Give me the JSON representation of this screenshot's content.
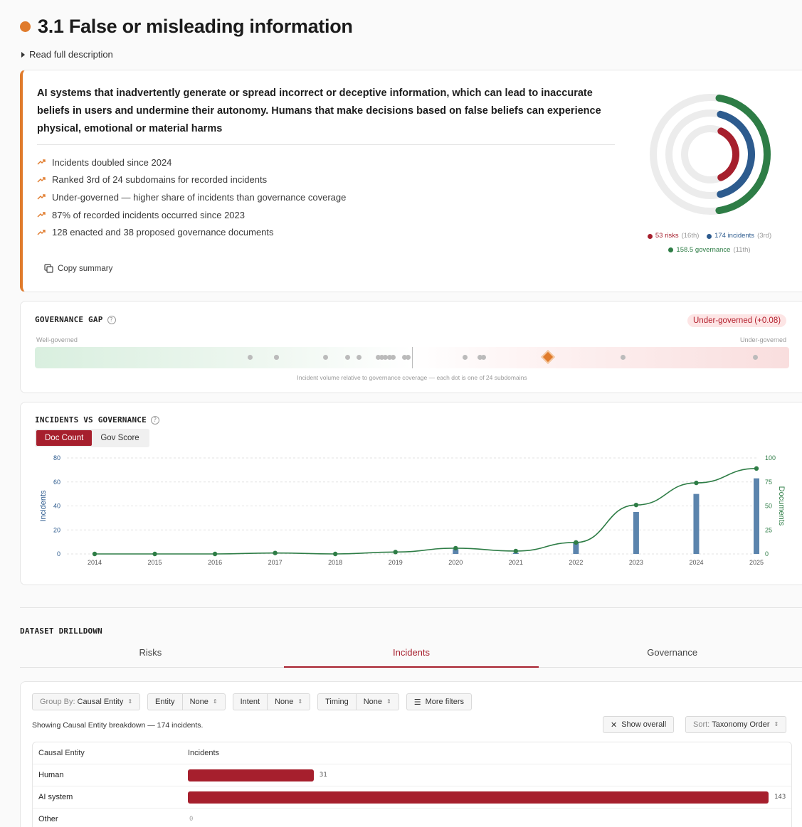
{
  "header": {
    "title": "3.1 False or misleading information",
    "read_description": "Read full description"
  },
  "summary": {
    "lead": "AI systems that inadvertently generate or spread incorrect or deceptive information, which can lead to inaccurate beliefs in users and undermine their autonomy. Humans that make decisions based on false beliefs can experience physical, emotional or material harms",
    "insights": [
      "Incidents doubled since 2024",
      "Ranked 3rd of 24 subdomains for recorded incidents",
      "Under-governed — higher share of incidents than governance coverage",
      "87% of recorded incidents occurred since 2023",
      "128 enacted and 38 proposed governance documents"
    ],
    "copy_label": "Copy summary",
    "rings": {
      "risks": {
        "label": "53 risks",
        "rank": "(16th)",
        "color": "#a61f2d",
        "fraction": 0.36
      },
      "incidents": {
        "label": "174 incidents",
        "rank": "(3rd)",
        "color": "#2d5b8e",
        "fraction": 0.42
      },
      "governance": {
        "label": "158.5 governance",
        "rank": "(11th)",
        "color": "#2e7d46",
        "fraction": 0.45
      }
    },
    "accent_color": "#e07b2c"
  },
  "gap": {
    "label": "GOVERNANCE GAP",
    "badge": "Under-governed (+0.08)",
    "left_label": "Well-governed",
    "right_label": "Under-governed",
    "caption": "Incident volume relative to governance coverage — each dot is one of 24 subdomains",
    "subdomain_scores": [
      0.285,
      0.32,
      0.32,
      0.385,
      0.415,
      0.43,
      0.455,
      0.46,
      0.465,
      0.47,
      0.475,
      0.49,
      0.495,
      0.57,
      0.59,
      0.595,
      0.78,
      0.955
    ],
    "current_score": 0.68
  },
  "chart": {
    "label": "INCIDENTS VS GOVERNANCE",
    "toggle": [
      "Doc Count",
      "Gov Score"
    ],
    "active_toggle": "Doc Count"
  },
  "chart_data": {
    "type": "bar",
    "categories": [
      "2014",
      "2015",
      "2016",
      "2017",
      "2018",
      "2019",
      "2020",
      "2021",
      "2022",
      "2023",
      "2024",
      "2025"
    ],
    "series": [
      {
        "name": "Incidents",
        "type": "bar",
        "axis": "left",
        "color": "#5b84ad",
        "values": [
          0,
          0,
          0,
          0,
          0,
          0,
          4,
          1,
          10,
          35,
          50,
          63
        ]
      },
      {
        "name": "Documents",
        "type": "line",
        "axis": "right",
        "color": "#2e7d46",
        "values": [
          0,
          0,
          0,
          1,
          0,
          2,
          6,
          3,
          12,
          51,
          74,
          89
        ]
      }
    ],
    "ylabel": "Incidents",
    "y2label": "Documents",
    "ylim": [
      0,
      80
    ],
    "y2lim": [
      0,
      100
    ],
    "yticks": [
      0,
      20,
      40,
      60,
      80
    ],
    "y2ticks": [
      0,
      25,
      50,
      75,
      100
    ]
  },
  "drilldown": {
    "label": "DATASET DRILLDOWN",
    "tabs": [
      "Risks",
      "Incidents",
      "Governance"
    ],
    "active_tab": "Incidents",
    "filters": {
      "group_by_prefix": "Group By:",
      "group_by_value": "Causal Entity",
      "entity": "Entity",
      "entity_value": "None",
      "intent": "Intent",
      "intent_value": "None",
      "timing": "Timing",
      "timing_value": "None",
      "more": "More filters"
    },
    "showing": "Showing Causal Entity breakdown — 174 incidents.",
    "show_overall": "Show overall",
    "sort_prefix": "Sort:",
    "sort_value": "Taxonomy Order",
    "table": {
      "columns": [
        "Causal Entity",
        "Incidents"
      ],
      "max": 143,
      "rows": [
        {
          "name": "Human",
          "value": 31
        },
        {
          "name": "AI system",
          "value": 143
        },
        {
          "name": "Other",
          "value": 0
        }
      ]
    }
  }
}
